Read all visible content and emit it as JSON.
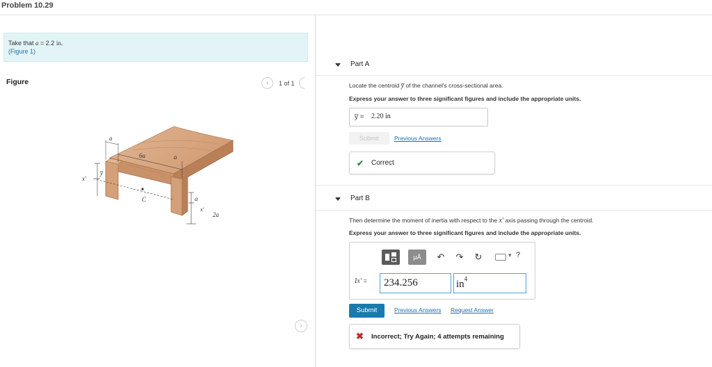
{
  "header": {
    "title": "Problem 10.29"
  },
  "givens": {
    "text_prefix": "Take that ",
    "var": "a",
    "text_eq": " = 2.2 ",
    "unit": "in.",
    "figure_link": "(Figure 1)"
  },
  "figure": {
    "heading": "Figure",
    "counter": "1 of 1",
    "prev_icon": "chevron-left-icon",
    "next_icon": "chevron-right-icon",
    "labels": {
      "a": "a",
      "six_a": "6a",
      "two_a": "2a",
      "y_bar": "y̅",
      "x_prime": "x′",
      "c": "C"
    }
  },
  "part_a": {
    "label": "Part A",
    "question_prefix": "Locate the centroid ",
    "question_var": "y̅",
    "question_suffix": " of the channel's cross-sectional area.",
    "instruction": "Express your answer to three significant figures and include the appropriate units.",
    "answer_label": "y̅ =",
    "answer_value": "2.20 in",
    "submit": "Submit",
    "previous_answers": "Previous Answers",
    "feedback": "Correct"
  },
  "part_b": {
    "label": "Part B",
    "question_prefix": "Then determine the moment of inertia with respect to the ",
    "question_var": "x′",
    "question_suffix": " axis passing through the centroid.",
    "instruction": "Express your answer to three significant figures and include the appropriate units.",
    "toolbar": {
      "units_label": "μÅ",
      "undo": "↶",
      "redo": "↷",
      "reset": "↻",
      "help": "?"
    },
    "answer_label": "Ix′",
    "answer_eq": " =",
    "value": "234.256",
    "unit": "in",
    "unit_exp": "4",
    "submit": "Submit",
    "previous_answers": "Previous Answers",
    "request_answer": "Request Answer",
    "feedback": "Incorrect; Try Again; 4 attempts remaining"
  },
  "colors": {
    "accent": "#1a7aad",
    "givens_bg": "#e3f4f7",
    "correct": "#2e8b57",
    "incorrect": "#c0282d",
    "wood": "#d9a883"
  }
}
